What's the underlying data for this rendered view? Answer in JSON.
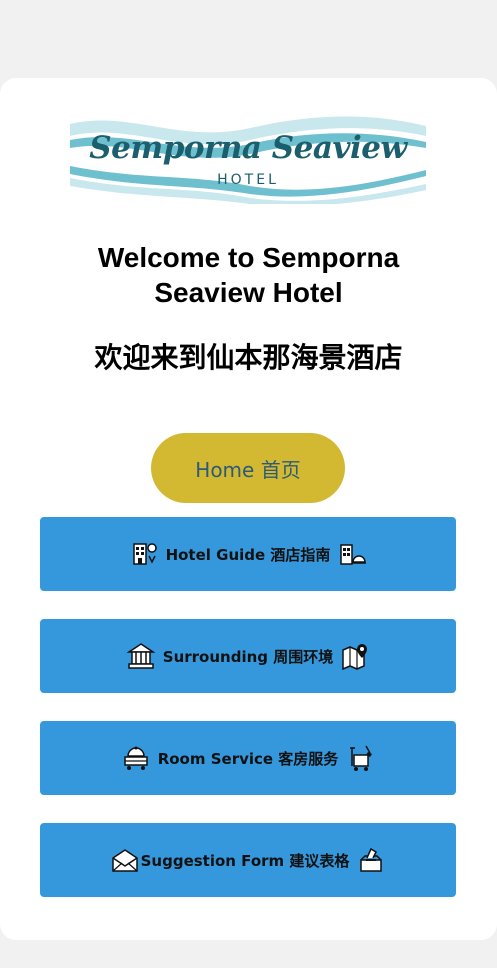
{
  "logo": {
    "title": "Semporna Seaview",
    "subtitle": "HOTEL",
    "colors": {
      "text": "#1b5e6d",
      "wave_dark": "#6fc0cf",
      "wave_light": "#c9e8ee"
    }
  },
  "welcome": {
    "en": "Welcome to Semporna Seaview Hotel",
    "zh": "欢迎来到仙本那海景酒店"
  },
  "home_button": {
    "label": "Home 首页",
    "color": "#d3b931"
  },
  "menu": {
    "button_color": "#3598dc",
    "items": [
      {
        "label": "Hotel Guide 酒店指南",
        "left_icon": "building-pin-icon",
        "right_icon": "hotel-bell-icon"
      },
      {
        "label": "Surrounding 周围环境",
        "left_icon": "temple-icon",
        "right_icon": "map-pin-icon"
      },
      {
        "label": "Room Service 客房服务",
        "left_icon": "room-service-cart-icon",
        "right_icon": "cleaning-cart-icon"
      },
      {
        "label": "Suggestion Form 建议表格",
        "left_icon": "envelope-icon",
        "right_icon": "ballot-box-icon"
      }
    ]
  }
}
